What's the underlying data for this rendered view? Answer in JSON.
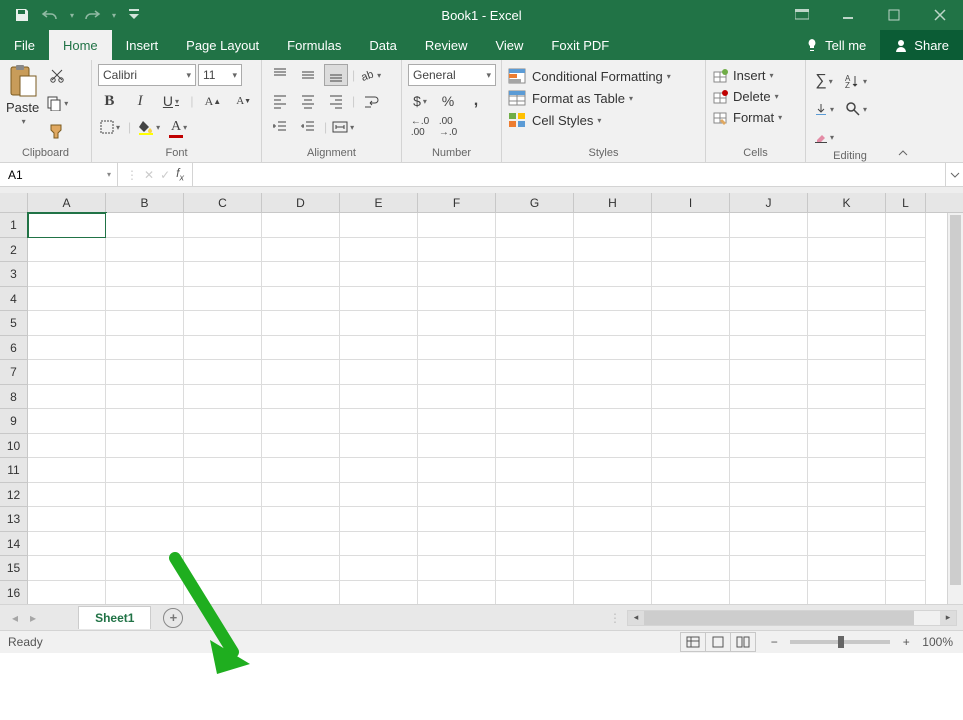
{
  "titlebar": {
    "title": "Book1 - Excel"
  },
  "tabs": {
    "file": "File",
    "home": "Home",
    "insert": "Insert",
    "pageLayout": "Page Layout",
    "formulas": "Formulas",
    "data": "Data",
    "review": "Review",
    "view": "View",
    "foxitPdf": "Foxit PDF",
    "tellMe": "Tell me",
    "share": "Share"
  },
  "ribbon": {
    "clipboard": {
      "paste": "Paste",
      "label": "Clipboard"
    },
    "font": {
      "name": "Calibri",
      "size": "11",
      "bold": "B",
      "italic": "I",
      "underline": "U",
      "label": "Font"
    },
    "alignment": {
      "label": "Alignment"
    },
    "number": {
      "format": "General",
      "label": "Number"
    },
    "styles": {
      "condFmt": "Conditional Formatting",
      "asTable": "Format as Table",
      "cellStyles": "Cell Styles",
      "label": "Styles"
    },
    "cells": {
      "insert": "Insert",
      "delete": "Delete",
      "format": "Format",
      "label": "Cells"
    },
    "editing": {
      "label": "Editing"
    }
  },
  "formulaBar": {
    "nameBox": "A1",
    "formula": ""
  },
  "grid": {
    "columns": [
      "A",
      "B",
      "C",
      "D",
      "E",
      "F",
      "G",
      "H",
      "I",
      "J",
      "K",
      "L"
    ],
    "rows": [
      "1",
      "2",
      "3",
      "4",
      "5",
      "6",
      "7",
      "8",
      "9",
      "10",
      "11",
      "12",
      "13",
      "14",
      "15",
      "16"
    ],
    "selected": "A1"
  },
  "sheets": {
    "active": "Sheet1"
  },
  "status": {
    "ready": "Ready",
    "zoom": "100%"
  }
}
